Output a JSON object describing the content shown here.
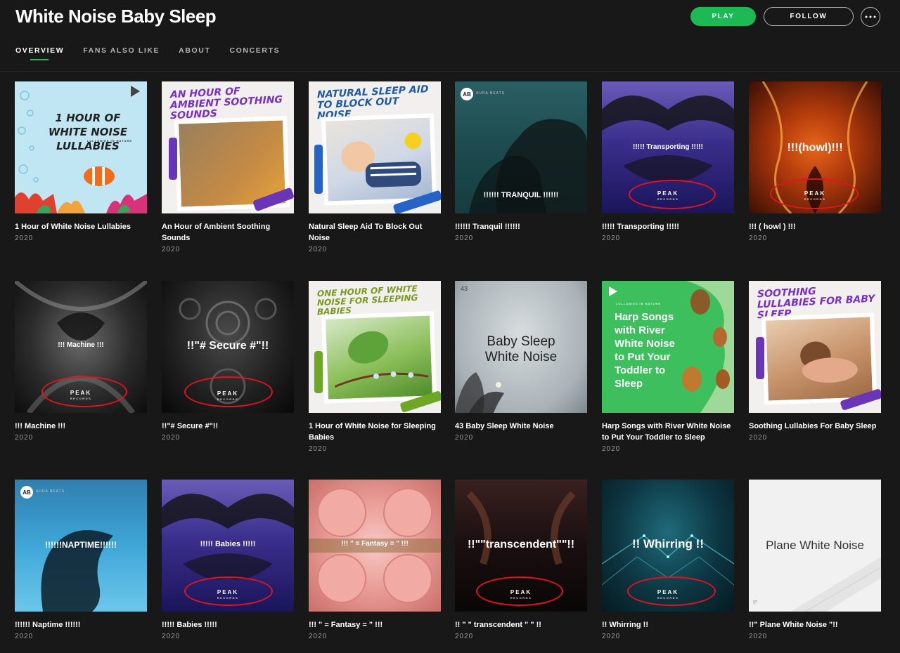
{
  "artist": {
    "title": "White Noise Baby Sleep"
  },
  "actions": {
    "play": "PLAY",
    "follow": "FOLLOW",
    "more_icon": "ellipsis-icon"
  },
  "tabs": [
    "OVERVIEW",
    "FANS ALSO LIKE",
    "ABOUT",
    "CONCERTS"
  ],
  "albums": [
    {
      "title": "1 Hour of White Noise Lullabies",
      "year": "2020",
      "cover": {
        "text": "1 HOUR OF WHITE NOISE LULLABIES",
        "subtext": "LULLABIES IN NATURE"
      }
    },
    {
      "title": "An Hour of Ambient Soothing Sounds",
      "year": "2020",
      "cover": {
        "text": "AN HOUR OF AMBIENT SOOTHING SOUNDS"
      }
    },
    {
      "title": "Natural Sleep Aid To Block Out Noise",
      "year": "2020",
      "cover": {
        "text": "NATURAL SLEEP AID TO BLOCK OUT NOISE"
      }
    },
    {
      "title": "!!!!!! Tranquil !!!!!!",
      "year": "2020",
      "cover": {
        "text": "!!!!!! TRANQUIL !!!!!!",
        "badge": "AB",
        "badge_label": "AURA BEATS"
      }
    },
    {
      "title": "!!!!! Transporting !!!!!",
      "year": "2020",
      "cover": {
        "text": "!!!!! Transporting !!!!!",
        "logo": "PEAK",
        "logo_sub": "RECORDS"
      }
    },
    {
      "title": "!!! ( howl ) !!!",
      "year": "2020",
      "cover": {
        "text": "!!!(howl)!!!",
        "logo": "PEAK",
        "logo_sub": "RECORDS"
      }
    },
    {
      "title": "!!! Machine !!!",
      "year": "2020",
      "cover": {
        "text": "!!! Machine !!!",
        "logo": "PEAK",
        "logo_sub": "RECORDS"
      }
    },
    {
      "title": "!!\"# Secure #\"!!",
      "year": "2020",
      "cover": {
        "text": "!!\"# Secure #\"!!",
        "logo": "PEAK",
        "logo_sub": "RECORDS"
      }
    },
    {
      "title": "1 Hour of White Noise for Sleeping Babies",
      "year": "2020",
      "cover": {
        "text": "ONE HOUR OF WHITE NOISE FOR SLEEPING BABIES"
      }
    },
    {
      "title": "43 Baby Sleep White Noise",
      "year": "2020",
      "cover": {
        "text": "Baby Sleep White Noise",
        "number": "43"
      }
    },
    {
      "title": "Harp Songs with River White Noise to Put Your Toddler to Sleep",
      "year": "2020",
      "cover": {
        "text": "Harp Songs with River White Noise to Put Your Toddler to Sleep",
        "subtext": "LULLABIES IN NATURE"
      }
    },
    {
      "title": "Soothing Lullabies For Baby Sleep",
      "year": "2020",
      "cover": {
        "text": "SOOTHING LULLABIES FOR BABY SLEEP"
      }
    },
    {
      "title": "!!!!!! Naptime !!!!!!",
      "year": "2020",
      "cover": {
        "text": "!!!!!!NAPTIME!!!!!!",
        "badge": "AB",
        "badge_label": "AURA BEATS"
      }
    },
    {
      "title": "!!!!! Babies !!!!!",
      "year": "2020",
      "cover": {
        "text": "!!!!! Babies !!!!!",
        "logo": "PEAK",
        "logo_sub": "RECORDS"
      }
    },
    {
      "title": "!!! \" = Fantasy = \" !!!",
      "year": "2020",
      "cover": {
        "text": "!!! \" = Fantasy = \" !!!"
      }
    },
    {
      "title": "!! \" \" transcendent \" \" !!",
      "year": "2020",
      "cover": {
        "text": "!!\"\"transcendent\"\"!!",
        "logo": "PEAK",
        "logo_sub": "RECORDS"
      }
    },
    {
      "title": "!! Whirring !!",
      "year": "2020",
      "cover": {
        "text": "!! Whirring !!",
        "logo": "PEAK",
        "logo_sub": "RECORDS"
      }
    },
    {
      "title": "!!\" Plane White Noise \"!!",
      "year": "2020",
      "cover": {
        "text": "Plane White Noise",
        "footer": "!!\""
      }
    }
  ],
  "colors": {
    "accent": "#1db954",
    "background": "#181818",
    "annotation": "#e0141e"
  }
}
